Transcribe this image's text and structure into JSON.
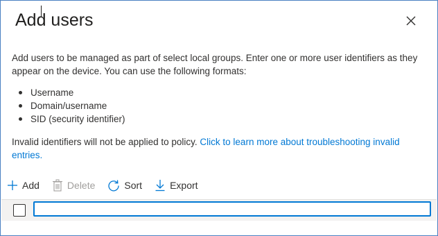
{
  "dialog": {
    "title": "Add users",
    "close_icon": "close-icon",
    "intro": "Add users to be managed as part of select local groups. Enter one or more user identifiers as they appear on the device. You can use the following formats:",
    "formats": [
      "Username",
      "Domain/username",
      "SID (security identifier)"
    ],
    "invalid_note": "Invalid identifiers will not be applied to policy.",
    "learn_more_link": "Click to learn more about troubleshooting invalid entries.",
    "link_color": "#0078d4",
    "border_color": "#4a80c2"
  },
  "toolbar": {
    "add_label": "Add",
    "add_icon": "plus-icon",
    "delete_label": "Delete",
    "delete_icon": "trash-icon",
    "delete_disabled": true,
    "sort_label": "Sort",
    "sort_icon": "refresh-icon",
    "export_label": "Export",
    "export_icon": "download-icon"
  },
  "grid": {
    "row_checked": false,
    "input_value": "",
    "input_placeholder": ""
  }
}
